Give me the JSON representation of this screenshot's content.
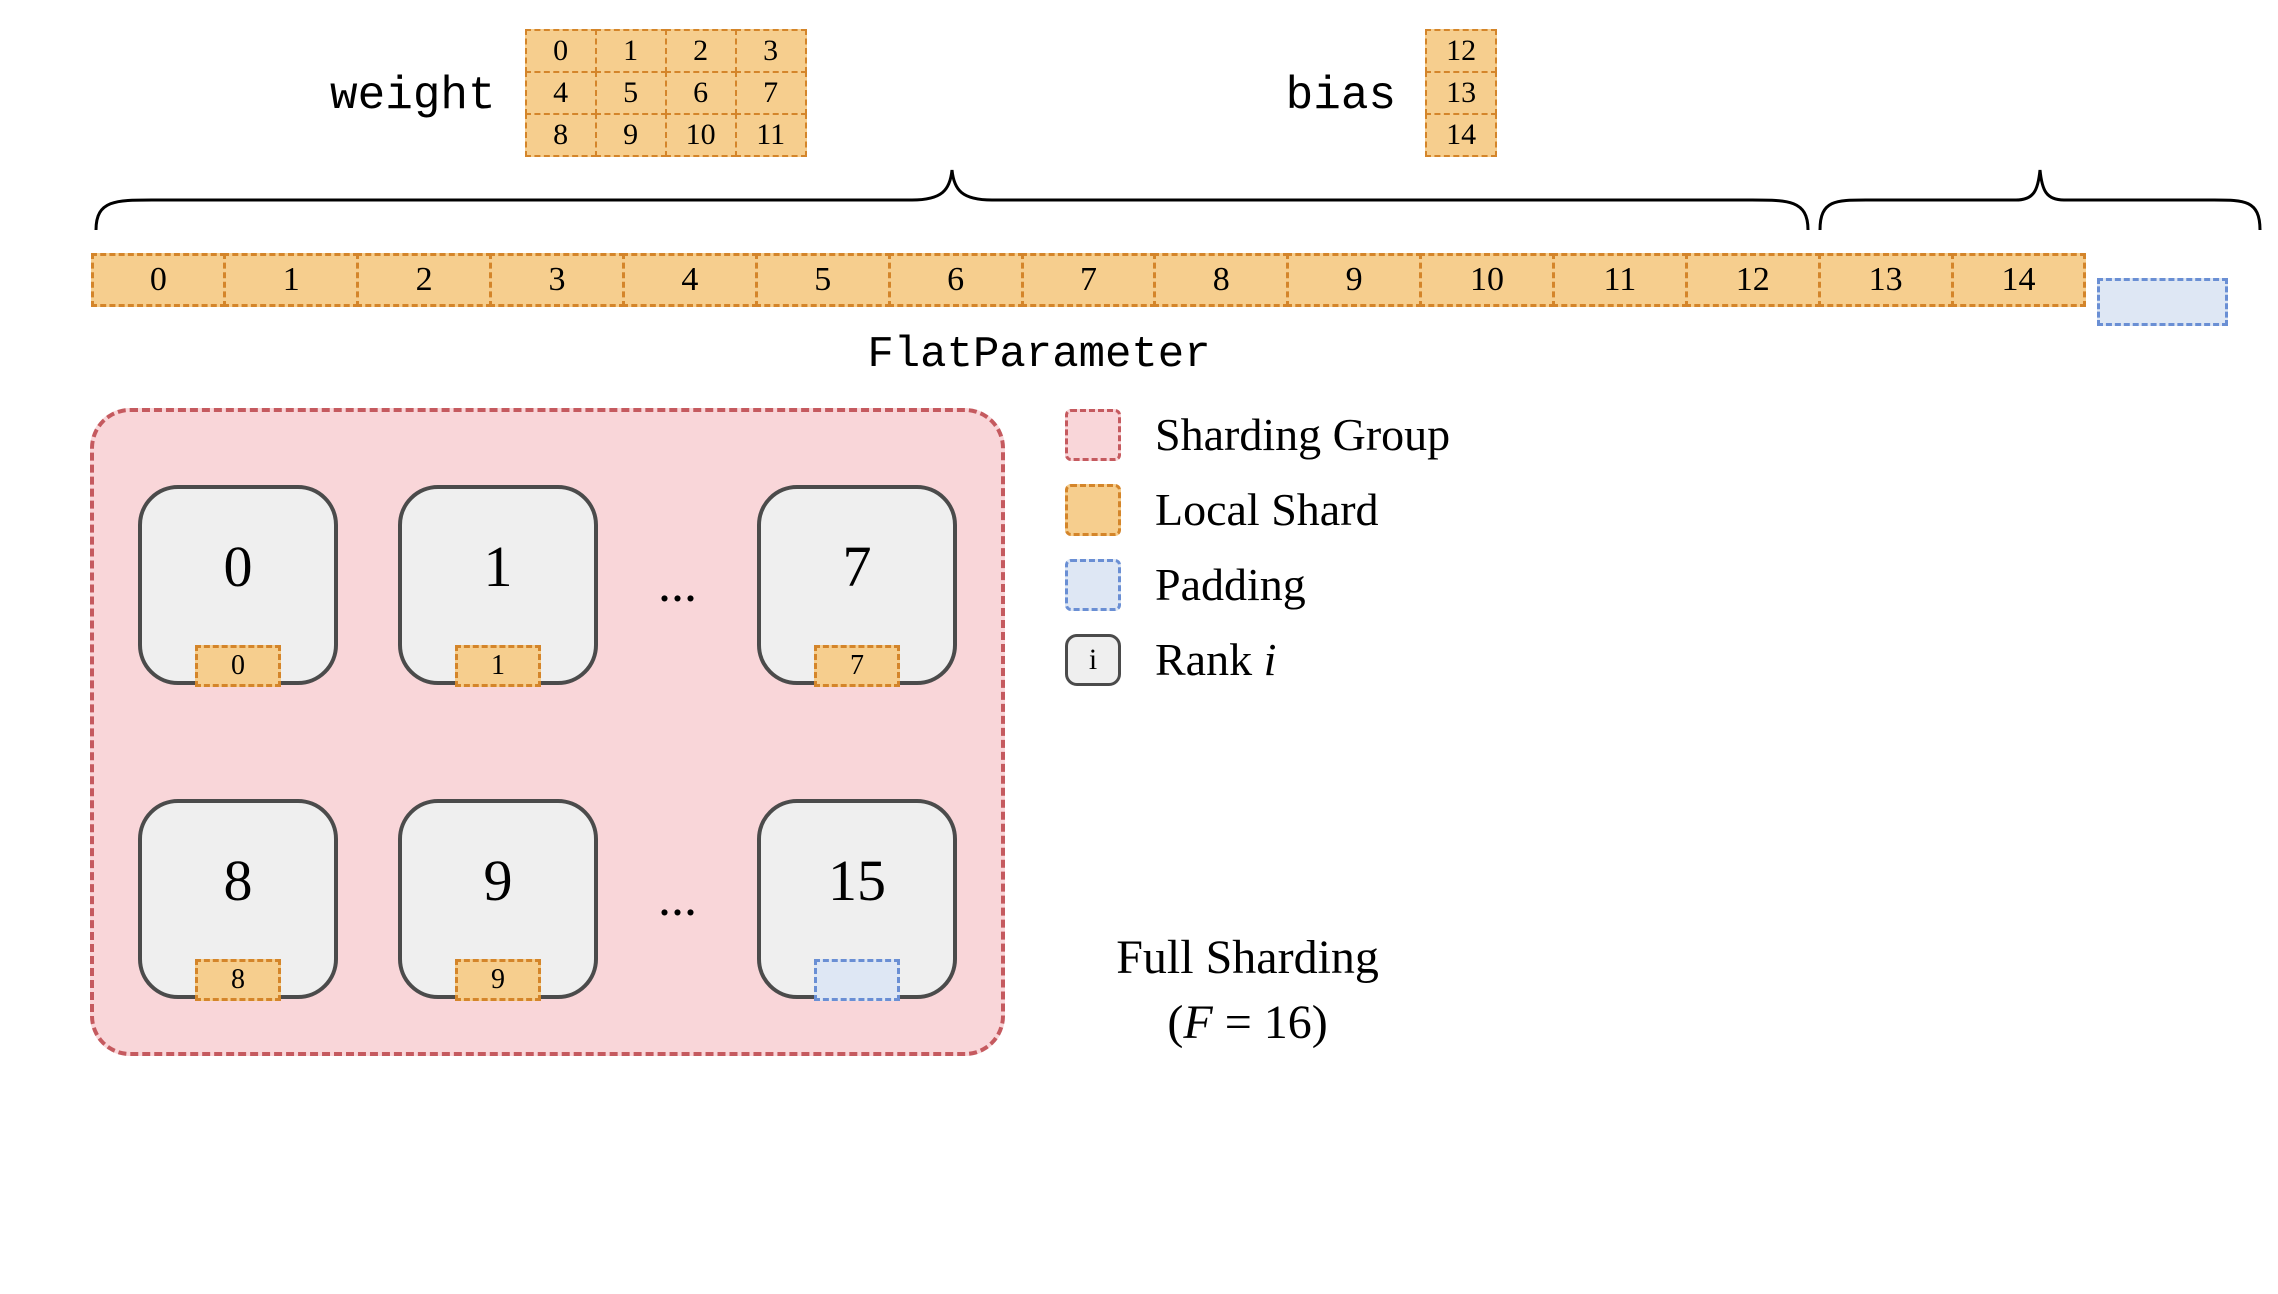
{
  "labels": {
    "weight": "weight",
    "bias": "bias",
    "flat": "FlatParameter",
    "dots": "..."
  },
  "weight_cells": [
    "0",
    "1",
    "2",
    "3",
    "4",
    "5",
    "6",
    "7",
    "8",
    "9",
    "10",
    "11"
  ],
  "bias_cells": [
    "12",
    "13",
    "14"
  ],
  "flat_cells": [
    "0",
    "1",
    "2",
    "3",
    "4",
    "5",
    "6",
    "7",
    "8",
    "9",
    "10",
    "11",
    "12",
    "13",
    "14"
  ],
  "ranks_top": [
    {
      "r": "0",
      "c": "0"
    },
    {
      "r": "1",
      "c": "1"
    },
    {
      "r": "7",
      "c": "7"
    }
  ],
  "ranks_bottom": [
    {
      "r": "8",
      "c": "8"
    },
    {
      "r": "9",
      "c": "9"
    },
    {
      "r": "15",
      "c": ""
    }
  ],
  "legend": {
    "group": "Sharding Group",
    "shard": "Local Shard",
    "pad": "Padding",
    "rank_i": "i",
    "rank_pre": "Rank ",
    "rank_var": "i"
  },
  "caption": {
    "l1": "Full Sharding",
    "l2a": "(",
    "l2b": "F",
    "l2c": " = 16)"
  }
}
